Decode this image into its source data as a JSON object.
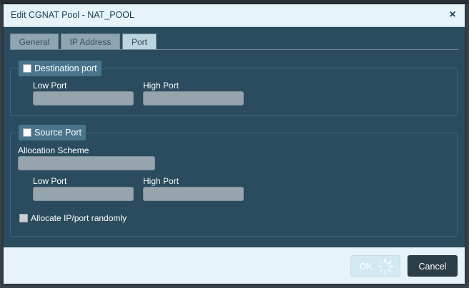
{
  "dialog": {
    "title": "Edit CGNAT Pool - NAT_POOL",
    "close_glyph": "×"
  },
  "tabs": [
    {
      "label": "General",
      "active": false
    },
    {
      "label": "IP Address",
      "active": false
    },
    {
      "label": "Port",
      "active": true
    }
  ],
  "destination_port": {
    "legend": "Destination port",
    "checked": false,
    "low_port_label": "Low Port",
    "low_port_value": "",
    "high_port_label": "High Port",
    "high_port_value": ""
  },
  "source_port": {
    "legend": "Source Port",
    "checked": false,
    "allocation_scheme_label": "Allocation Scheme",
    "allocation_scheme_value": "",
    "low_port_label": "Low Port",
    "low_port_value": "",
    "high_port_label": "High Port",
    "high_port_value": "",
    "allocate_random_label": "Allocate IP/port randomly",
    "allocate_random_checked": false
  },
  "footer": {
    "ok_label": "OK",
    "cancel_label": "Cancel"
  },
  "colors": {
    "dialog_body": "#2b4c5e",
    "titlebar": "#e6f3f8",
    "legend_bg": "#48758c",
    "input_bg": "#96a5ad",
    "cancel_bg": "#2c3e48"
  },
  "icons": {
    "close": "close-icon",
    "spinner": "loading-spinner-icon"
  }
}
